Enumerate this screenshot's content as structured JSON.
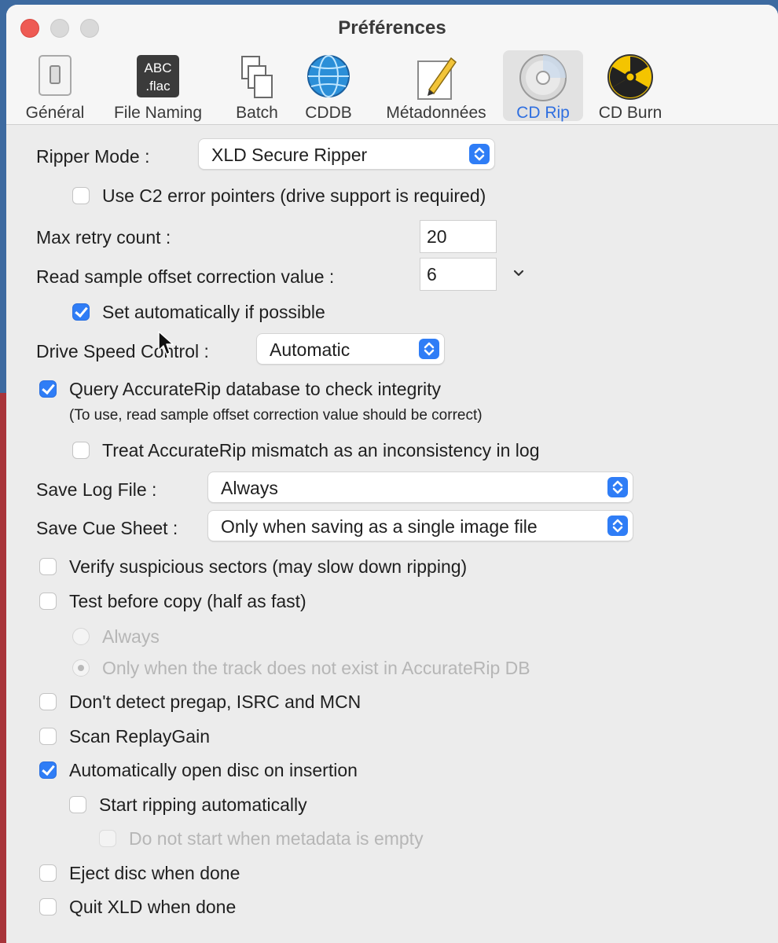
{
  "window": {
    "title": "Préférences"
  },
  "tabs": [
    {
      "label": "Général",
      "icon": "general-switch-icon"
    },
    {
      "label": "File Naming",
      "icon": "abc-flac-icon",
      "icon_text_top": "ABC",
      "icon_text_bottom": ".flac"
    },
    {
      "label": "Batch",
      "icon": "batch-documents-icon"
    },
    {
      "label": "CDDB",
      "icon": "globe-icon"
    },
    {
      "label": "Métadonnées",
      "icon": "edit-pencil-icon"
    },
    {
      "label": "CD Rip",
      "icon": "cd-disc-icon",
      "active": true
    },
    {
      "label": "CD Burn",
      "icon": "radiation-icon"
    }
  ],
  "form": {
    "ripper_mode_label": "Ripper Mode :",
    "ripper_mode_value": "XLD Secure Ripper",
    "c2_label": "Use C2 error pointers (drive support is required)",
    "c2_checked": false,
    "max_retry_label": "Max retry count :",
    "max_retry_value": "20",
    "offset_label": "Read sample offset correction value :",
    "offset_value": "6",
    "set_auto_label": "Set automatically if possible",
    "set_auto_checked": true,
    "drive_speed_label": "Drive Speed Control :",
    "drive_speed_value": "Automatic",
    "accuraterip_label": "Query AccurateRip database to check integrity",
    "accuraterip_checked": true,
    "accuraterip_note": "(To use, read sample offset correction value should be correct)",
    "treat_mismatch_label": "Treat AccurateRip mismatch as an inconsistency in log",
    "treat_mismatch_checked": false,
    "save_log_label": "Save Log File :",
    "save_log_value": "Always",
    "save_cue_label": "Save Cue Sheet :",
    "save_cue_value": "Only when saving as a single image file",
    "verify_label": "Verify suspicious sectors (may slow down ripping)",
    "verify_checked": false,
    "test_before_label": "Test before copy (half as fast)",
    "test_before_checked": false,
    "radio_always_label": "Always",
    "radio_only_label": "Only when the track does not exist in AccurateRip DB",
    "pregap_label": "Don't detect pregap, ISRC and MCN",
    "pregap_checked": false,
    "replaygain_label": "Scan ReplayGain",
    "replaygain_checked": false,
    "auto_open_label": "Automatically open disc on insertion",
    "auto_open_checked": true,
    "start_ripping_label": "Start ripping automatically",
    "start_ripping_checked": false,
    "metadata_empty_label": "Do not start when metadata is empty",
    "metadata_empty_checked": false,
    "eject_label": "Eject disc when done",
    "eject_checked": false,
    "quit_label": "Quit XLD when done",
    "quit_checked": false
  },
  "colors": {
    "accent": "#2f7df6",
    "active_tab_text": "#2f6fe0",
    "close_button": "#ee5b54",
    "disabled_text": "#b6b6b6"
  }
}
